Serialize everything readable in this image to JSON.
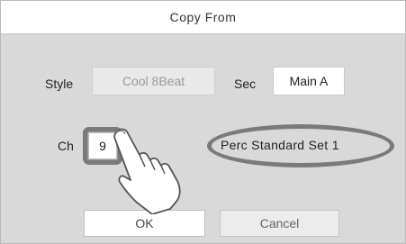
{
  "dialog": {
    "title": "Copy From"
  },
  "style_row": {
    "style_label": "Style",
    "style_value": "Cool 8Beat",
    "sec_label": "Sec",
    "sec_value": "Main A"
  },
  "channel_row": {
    "ch_label": "Ch",
    "ch_value": "9",
    "voice_name": "Perc  Standard Set 1"
  },
  "buttons": {
    "ok_label": "OK",
    "cancel_label": "Cancel"
  },
  "icons": {
    "pointer": "pointing-hand-icon"
  }
}
